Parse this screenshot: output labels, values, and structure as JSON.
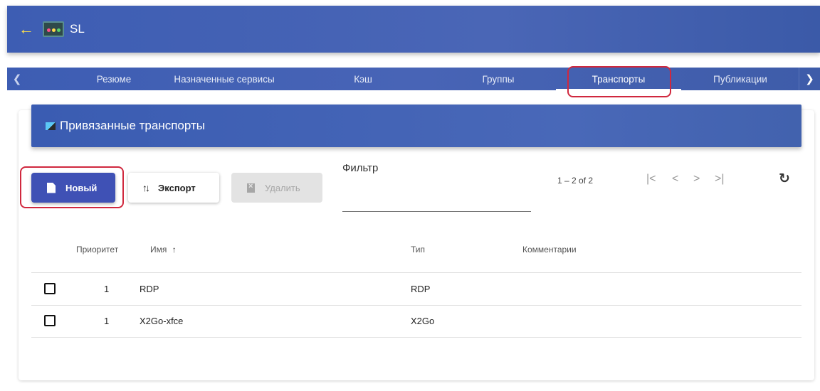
{
  "app": {
    "title": "SL",
    "back_icon": "arrow-left-icon",
    "logo_icon": "app-logo-icon"
  },
  "tabs": [
    {
      "label": "Резюме"
    },
    {
      "label": "Назначенные сервисы"
    },
    {
      "label": "Кэш"
    },
    {
      "label": "Группы"
    },
    {
      "label": "Транспорты",
      "active": true
    },
    {
      "label": "Публикации"
    }
  ],
  "card": {
    "title": "Привязанные транспорты"
  },
  "toolbar": {
    "new_label": "Новый",
    "export_label": "Экспорт",
    "delete_label": "Удалить",
    "delete_disabled": true
  },
  "filter": {
    "label": "Фильтр",
    "value": ""
  },
  "paginator": {
    "range": "1 – 2 of 2"
  },
  "table": {
    "columns": {
      "priority": "Приоритет",
      "name": "Имя",
      "name_sort": "↑",
      "type": "Тип",
      "comments": "Комментарии"
    },
    "rows": [
      {
        "priority": "1",
        "name": "RDP",
        "type": "RDP",
        "comments": ""
      },
      {
        "priority": "1",
        "name": "X2Go-xfce",
        "type": "X2Go",
        "comments": ""
      }
    ]
  },
  "colors": {
    "primary": "#3f51b5",
    "bar": "#4864b6",
    "highlight": "#d0283e",
    "back_arrow": "#ffe04a"
  }
}
